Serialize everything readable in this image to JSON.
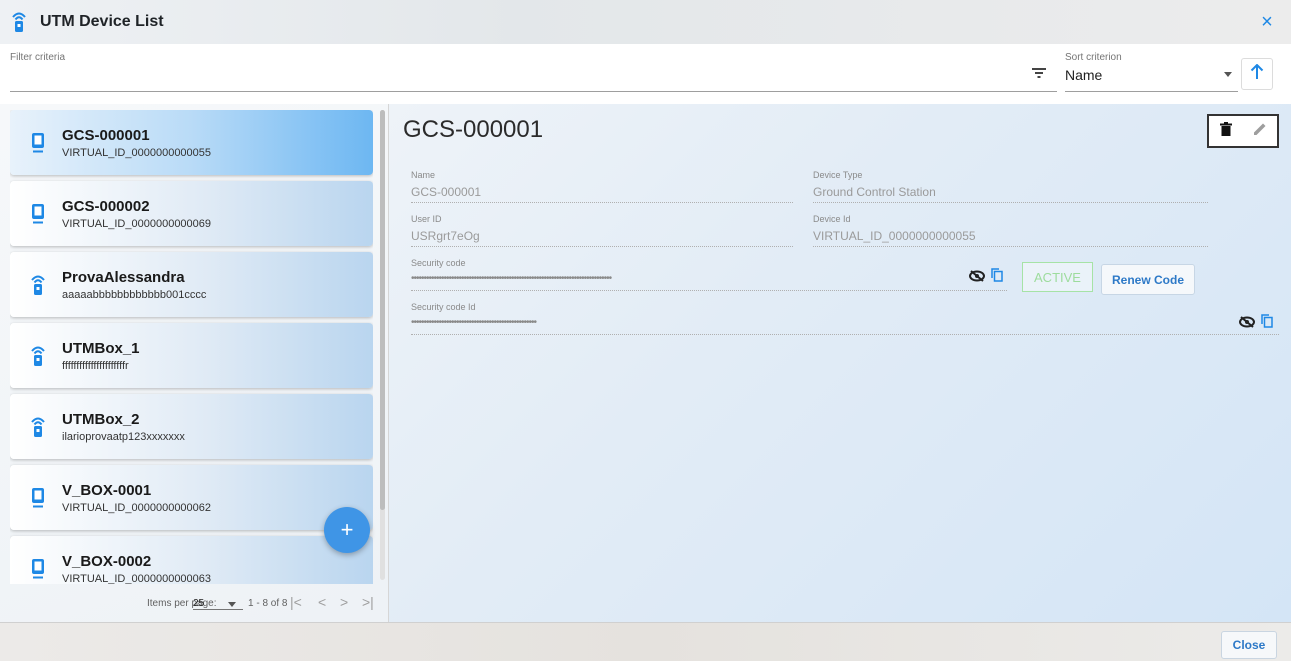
{
  "window": {
    "title": "UTM Device List",
    "close_glyph": "×"
  },
  "filter": {
    "label": "Filter criteria",
    "value": ""
  },
  "sort": {
    "label": "Sort criterion",
    "value": "Name"
  },
  "devices": [
    {
      "name": "GCS-000001",
      "id": "VIRTUAL_ID_0000000000055",
      "icon": "phone-icon",
      "selected": true
    },
    {
      "name": "GCS-000002",
      "id": "VIRTUAL_ID_0000000000069",
      "icon": "phone-icon",
      "selected": false
    },
    {
      "name": "ProvaAlessandra",
      "id": "aaaaabbbbbbbbbbbb001cccc",
      "icon": "wireless-beacon-icon",
      "selected": false
    },
    {
      "name": "UTMBox_1",
      "id": "ffffffffffffffffffffffr",
      "icon": "wireless-beacon-icon",
      "selected": false
    },
    {
      "name": "UTMBox_2",
      "id": "ilarioprovaatp123xxxxxxx",
      "icon": "wireless-beacon-icon",
      "selected": false
    },
    {
      "name": "V_BOX-0001",
      "id": "VIRTUAL_ID_0000000000062",
      "icon": "phone-icon",
      "selected": false
    },
    {
      "name": "V_BOX-0002",
      "id": "VIRTUAL_ID_0000000000063",
      "icon": "phone-icon",
      "selected": false
    }
  ],
  "fab": {
    "label": "+"
  },
  "paginator": {
    "items_per_page_label": "Items per page:",
    "items_per_page_value": "25",
    "range_label": "1 - 8 of 8"
  },
  "detail": {
    "title": "GCS-000001",
    "fields": {
      "name_label": "Name",
      "name_value": "GCS-000001",
      "device_type_label": "Device Type",
      "device_type_value": "Ground Control Station",
      "user_id_label": "User ID",
      "user_id_value": "USRgrt7eOg",
      "device_id_label": "Device Id",
      "device_id_value": "VIRTUAL_ID_0000000000055",
      "security_code_label": "Security code",
      "security_code_value": "••••••••••••••••••••••••••••••••••••••••••••••••••••••••••••••••••••••••••••••••",
      "security_code_id_label": "Security code Id",
      "security_code_id_value": "••••••••••••••••••••••••••••••••••••••••••••••••••"
    },
    "status_label": "ACTIVE",
    "renew_label": "Renew Code"
  },
  "footer": {
    "close_label": "Close"
  },
  "colors": {
    "accent": "#1e88e5",
    "fab": "#3f95e6",
    "active_green": "#9ddc9d"
  }
}
